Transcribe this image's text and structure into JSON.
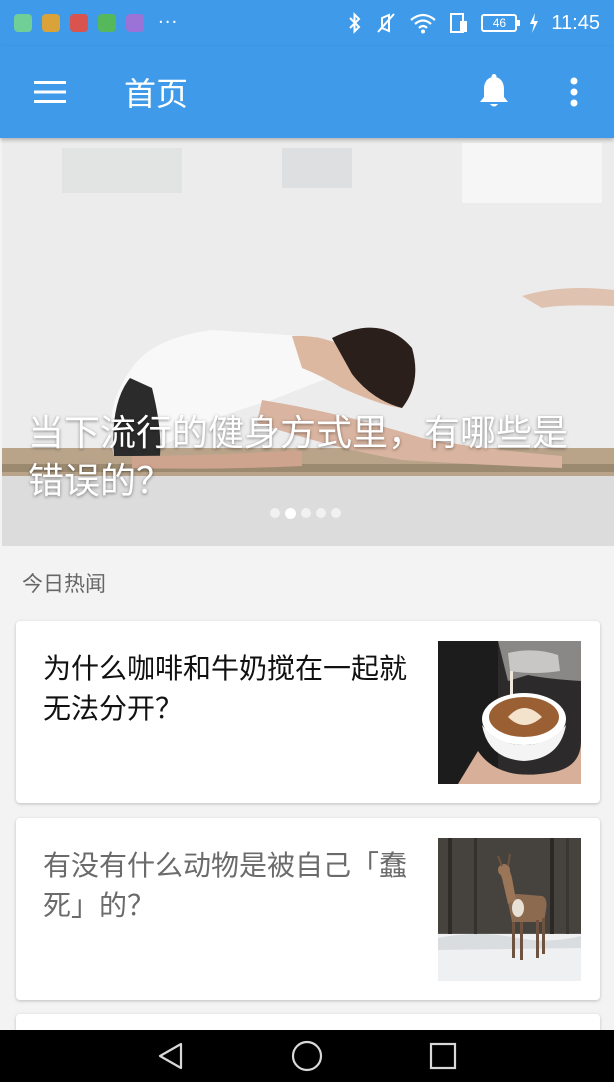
{
  "status_bar": {
    "notification_icons": [
      "android-debug-icon",
      "lock-app-icon",
      "blocked-app-icon",
      "shield-app-icon",
      "usb-app-icon"
    ],
    "more_indicator": "···",
    "battery_level": "46",
    "time": "11:45"
  },
  "toolbar": {
    "title": "首页",
    "menu_icon": "hamburger-menu-icon",
    "notification_icon": "bell-icon",
    "overflow_icon": "more-vert-icon"
  },
  "banner": {
    "title": "当下流行的健身方式里，有哪些是错误的？",
    "page_count": 5,
    "active_page": 1
  },
  "section": {
    "label": "今日热闻"
  },
  "news": [
    {
      "title": "为什么咖啡和牛奶搅在一起就无法分开？",
      "thumbnail": "coffee-latte-art-image"
    },
    {
      "title": "有没有什么动物是被自己「蠢死」的？",
      "thumbnail": "deer-in-snow-image"
    }
  ],
  "nav": {
    "back_icon": "back-triangle-icon",
    "home_icon": "home-circle-icon",
    "recents_icon": "recents-square-icon"
  },
  "colors": {
    "primary": "#3f9bea",
    "text_dark": "#111111",
    "text_read": "#6b6b6b",
    "background": "#f3f3f3"
  }
}
